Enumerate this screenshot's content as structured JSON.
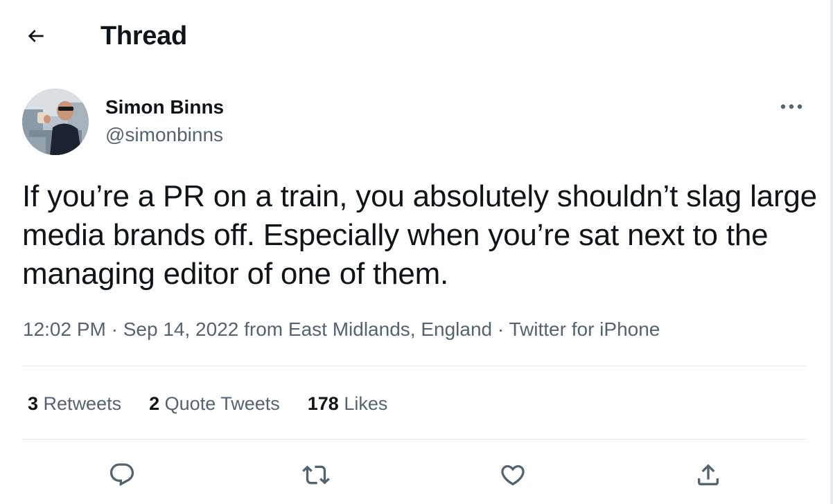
{
  "header": {
    "back_icon": "arrow-left-icon",
    "title": "Thread"
  },
  "tweet": {
    "author_name": "Simon Binns",
    "author_handle": "@simonbinns",
    "text": "If you’re a PR on a train, you absolutely shouldn’t slag large media brands off. Especially when you’re sat next to the managing editor of one of them.",
    "time": "12:02 PM",
    "date": "Sep 14, 2022",
    "location": "from East Midlands, England",
    "source": "Twitter for iPhone",
    "separator": "·"
  },
  "stats": {
    "retweets_count": "3",
    "retweets_label": "Retweets",
    "quotes_count": "2",
    "quotes_label": "Quote Tweets",
    "likes_count": "178",
    "likes_label": "Likes"
  },
  "actions": {
    "reply_icon": "reply-icon",
    "retweet_icon": "retweet-icon",
    "like_icon": "heart-icon",
    "share_icon": "share-icon"
  },
  "colors": {
    "text_primary": "#0f1419",
    "text_secondary": "#536471",
    "divider": "#e7ecf0",
    "background": "#ffffff"
  }
}
